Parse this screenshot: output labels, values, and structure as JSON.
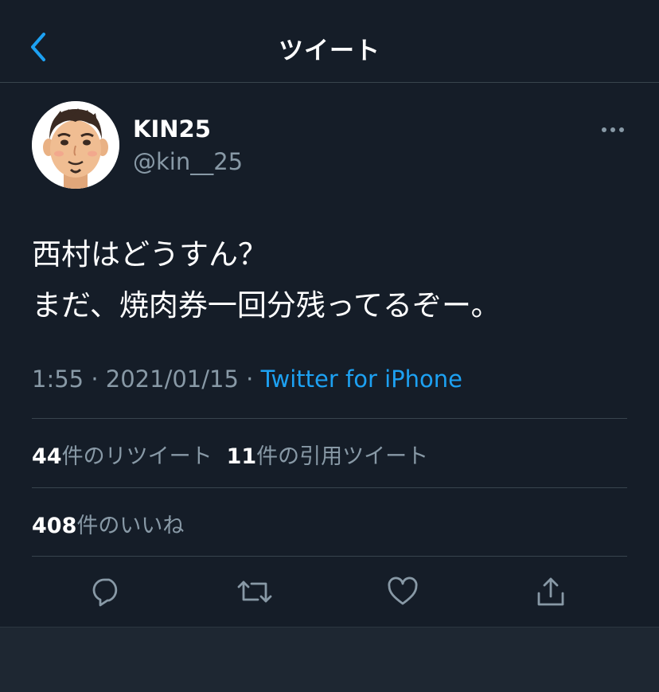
{
  "nav": {
    "title": "ツイート",
    "back_icon": "chevron-left-icon"
  },
  "author": {
    "display_name": "KIN25",
    "handle": "@kin__25",
    "avatar_icon": "cartoon-avatar"
  },
  "tweet": {
    "lines": [
      "西村はどうすん？",
      "まだ、焼肉券一回分残ってるぞー。"
    ],
    "time": "1:55",
    "separator": " · ",
    "date": "2021/01/15",
    "source": "Twitter for iPhone"
  },
  "stats": {
    "retweets_count": "44",
    "retweets_label": "件のリツイート",
    "quotes_count": "11",
    "quotes_label": "件の引用ツイート",
    "likes_count": "408",
    "likes_label": "件のいいね"
  },
  "actions": [
    "reply-icon",
    "retweet-icon",
    "like-icon",
    "share-icon"
  ],
  "colors": {
    "background": "#151d28",
    "accent": "#1da1f2",
    "secondary_text": "#8899a6",
    "divider": "#38444d"
  }
}
